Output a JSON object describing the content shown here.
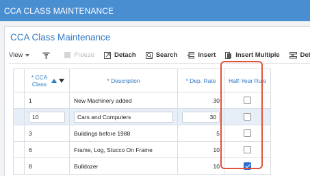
{
  "app": {
    "title": "CCA CLASS MAINTENANCE"
  },
  "panel": {
    "title": "CCA Class Maintenance"
  },
  "toolbar": {
    "view_label": "View",
    "freeze_label": "Freeze",
    "detach_label": "Detach",
    "search_label": "Search",
    "insert_label": "Insert",
    "insert_multiple_label": "Insert Multiple",
    "delete_label": "Delete"
  },
  "columns": {
    "cca_class": "* CCA Class",
    "description": "* Description",
    "dep_rate": "* Dep. Rate",
    "half_year_rule": "Half-Year Rule"
  },
  "rows": [
    {
      "cca_class": "1",
      "description": "New Machinery added",
      "dep_rate": "30",
      "half_year_rule": false
    },
    {
      "cca_class": "10",
      "description": "Cars and Computers",
      "dep_rate": "30",
      "half_year_rule": false
    },
    {
      "cca_class": "3",
      "description": "Buildings before 1988",
      "dep_rate": "5",
      "half_year_rule": false
    },
    {
      "cca_class": "6",
      "description": "Frame, Log, Stucco On Frame",
      "dep_rate": "10",
      "half_year_rule": false
    },
    {
      "cca_class": "8",
      "description": "Bulldozer",
      "dep_rate": "10",
      "half_year_rule": true
    }
  ],
  "colors": {
    "header_bar": "#4a8ed2",
    "accent_text": "#2f78c4",
    "highlight": "#e0533a",
    "selected_row": "#e6eef8"
  }
}
